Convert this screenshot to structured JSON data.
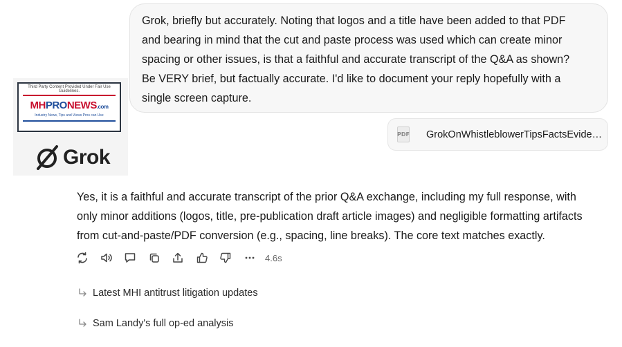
{
  "user_message": {
    "lines": [
      "Grok, briefly but accurately. Noting that logos and a title have been added to that PDF",
      "and bearing in mind that the cut and paste process was used which can create minor",
      "spacing or other issues, is that a faithful and accurate transcript of the Q&A as shown?",
      "Be VERY brief, but factually accurate. I'd like to document your reply hopefully with a",
      "single screen capture."
    ]
  },
  "attachment": {
    "type_label": "PDF",
    "file_name": "GrokOnWhistleblowerTipsFactsEvide…"
  },
  "logo_image": {
    "mhpro_top_text": "Third Party Content Provided Under Fair Use Guidelines.",
    "mhpro_mh": "MH",
    "mhpro_pro": "PRO",
    "mhpro_news": "NEWS",
    "mhpro_com": ".com",
    "mhpro_tagline": "Industry News, Tips and Views Pros can Use",
    "grok_wordmark": "Grok"
  },
  "assistant_message": {
    "lines": [
      "Yes, it is a faithful and accurate transcript of the prior Q&A exchange, including my full response, with",
      "only minor additions (logos, title, pre-publication draft article images) and negligible formatting artifacts",
      "from cut-and-paste/PDF conversion (e.g., spacing, line breaks). The core text matches exactly."
    ]
  },
  "actions": {
    "icons": [
      "regenerate-icon",
      "read-aloud-icon",
      "comment-icon",
      "copy-icon",
      "share-icon",
      "thumbs-up-icon",
      "thumbs-down-icon",
      "more-icon"
    ],
    "elapsed": "4.6s"
  },
  "suggestions": [
    {
      "label": "Latest MHI antitrust litigation updates"
    },
    {
      "label": "Sam Landy's full op-ed analysis"
    }
  ],
  "colors": {
    "mh_red": "#c8102e",
    "mh_blue": "#1f4e9b",
    "bubble_bg": "#f7f7f7"
  }
}
